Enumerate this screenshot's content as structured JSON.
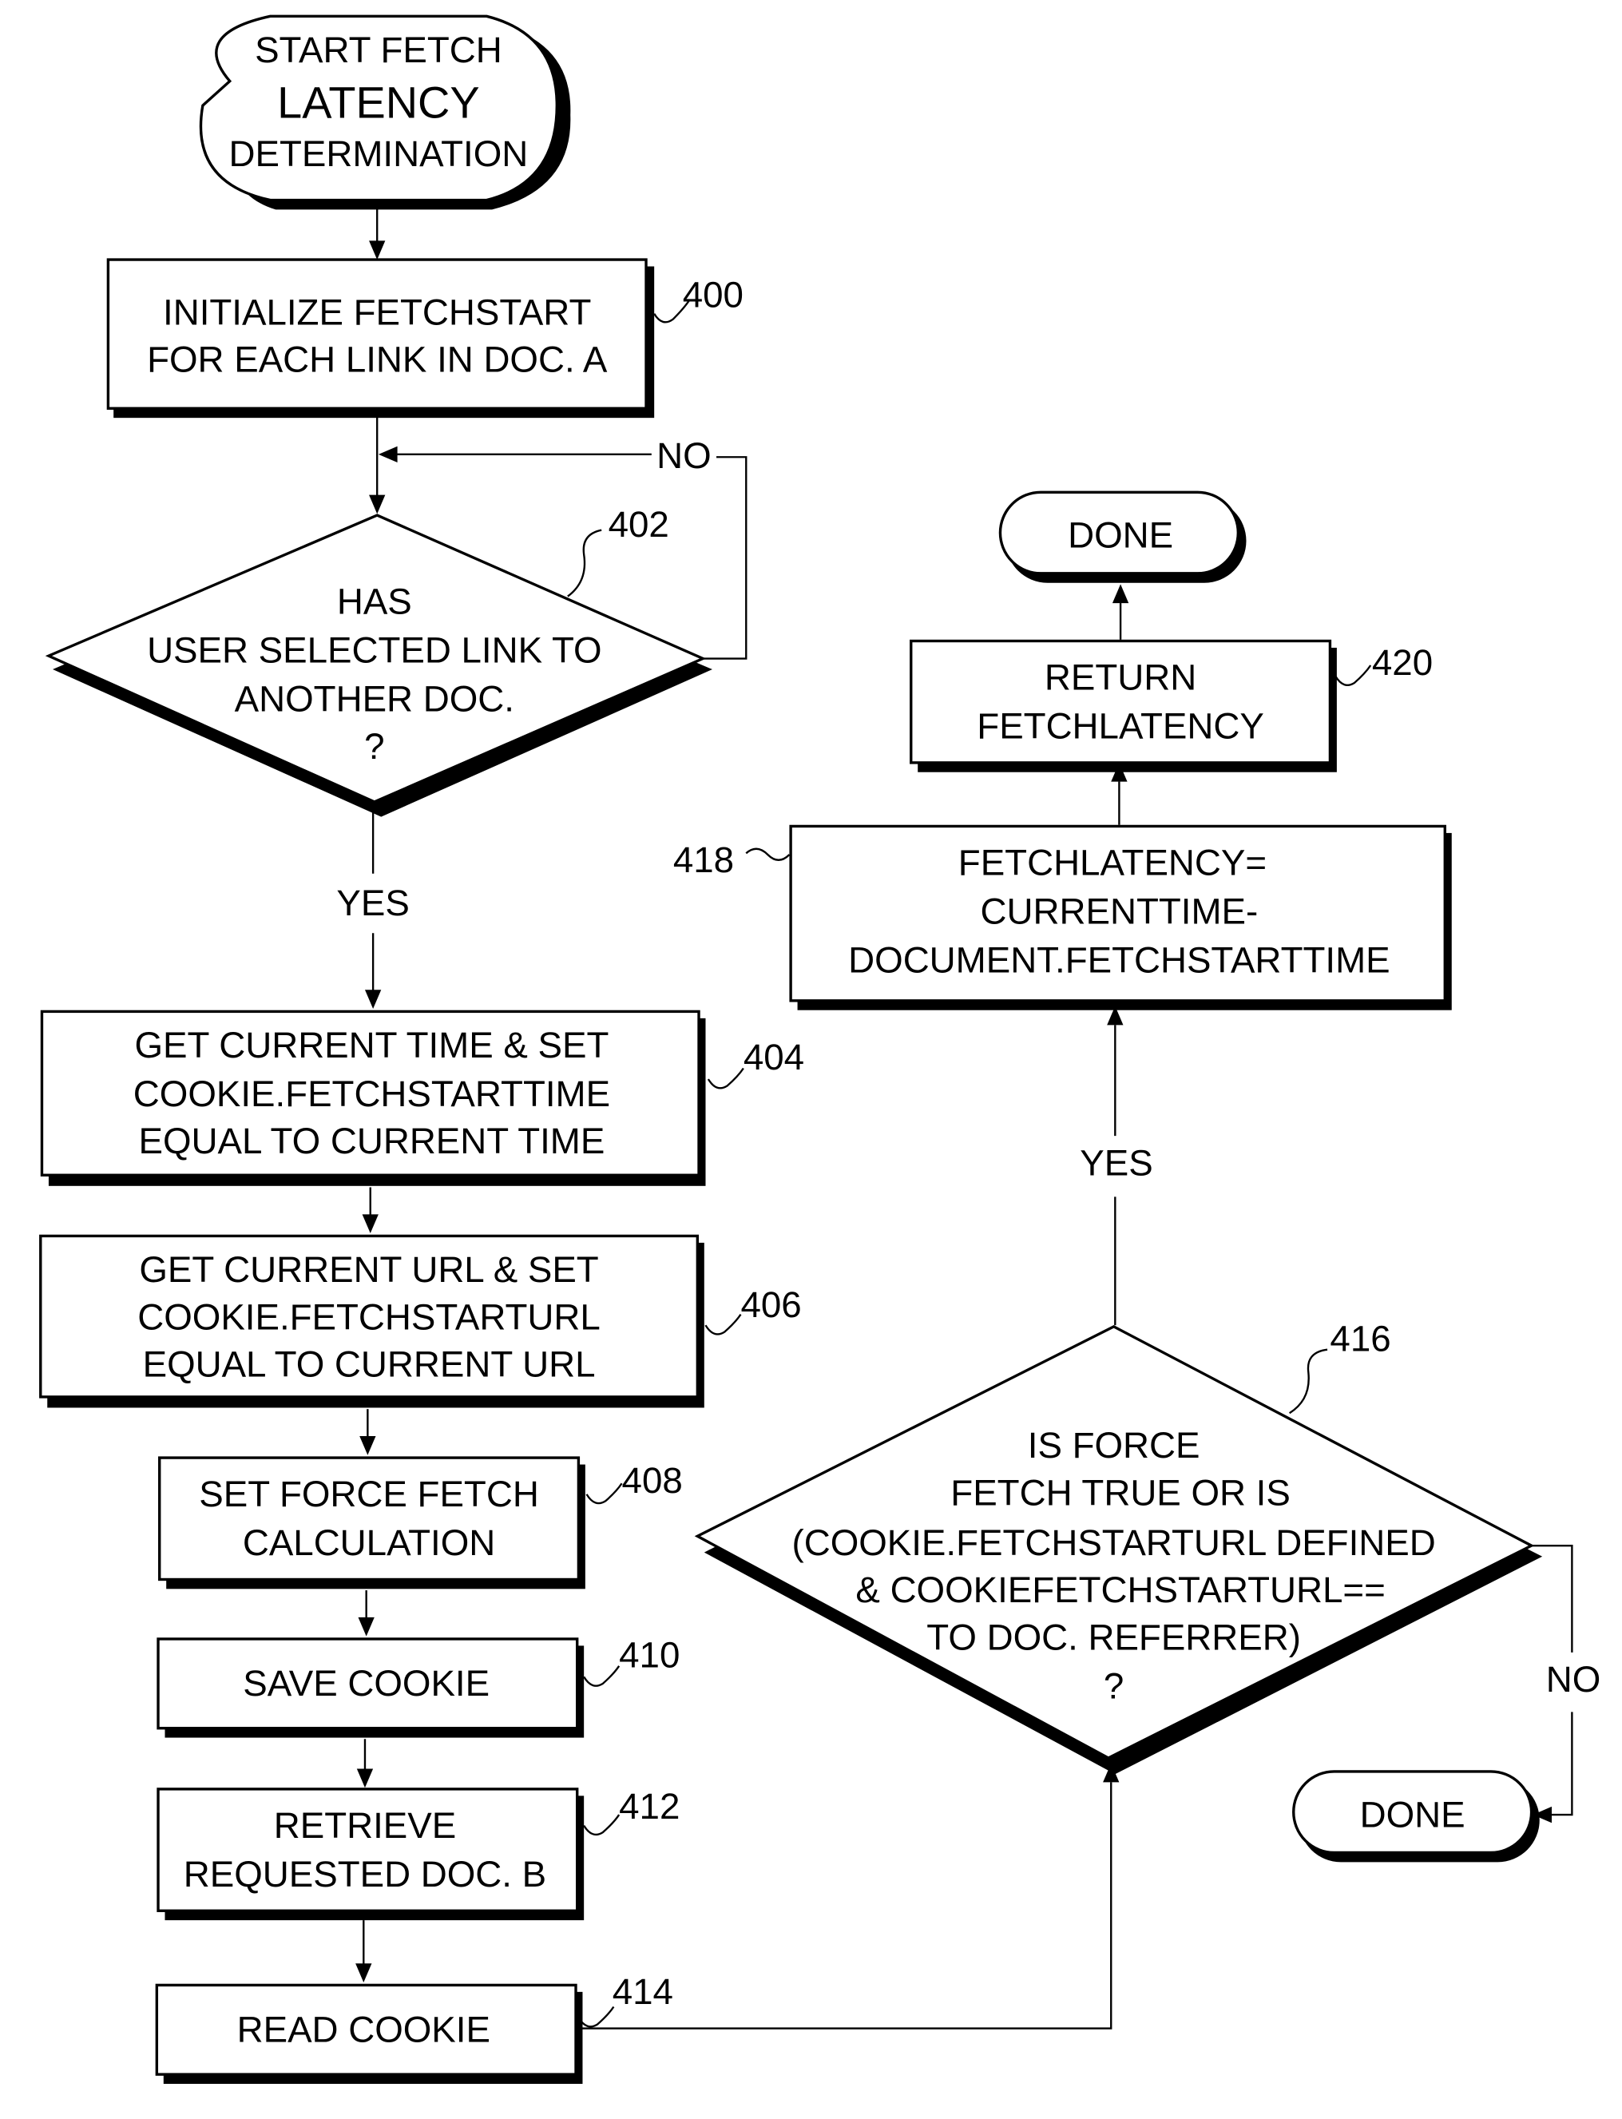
{
  "figure": {
    "type": "flowchart",
    "title": "Fetch latency determination"
  },
  "nodes": {
    "start": {
      "shape": "terminator",
      "lines": [
        "START FETCH",
        "LATENCY",
        "DETERMINATION"
      ]
    },
    "n400": {
      "ref": "400",
      "shape": "process",
      "lines": [
        "INITIALIZE FETCHSTART",
        "FOR EACH LINK IN DOC. A"
      ]
    },
    "n402": {
      "ref": "402",
      "shape": "decision",
      "lines": [
        "HAS",
        "USER SELECTED LINK TO",
        "ANOTHER DOC.",
        "?"
      ]
    },
    "n404": {
      "ref": "404",
      "shape": "process",
      "lines": [
        "GET CURRENT TIME & SET",
        "COOKIE.FETCHSTARTTIME",
        "EQUAL TO CURRENT TIME"
      ]
    },
    "n406": {
      "ref": "406",
      "shape": "process",
      "lines": [
        "GET CURRENT URL &  SET",
        "COOKIE.FETCHSTARTURL",
        "EQUAL TO CURRENT URL"
      ]
    },
    "n408": {
      "ref": "408",
      "shape": "process",
      "lines": [
        "SET FORCE FETCH",
        "CALCULATION"
      ]
    },
    "n410": {
      "ref": "410",
      "shape": "process",
      "lines": [
        "SAVE COOKIE"
      ]
    },
    "n412": {
      "ref": "412",
      "shape": "process",
      "lines": [
        "RETRIEVE",
        "REQUESTED DOC. B"
      ]
    },
    "n414": {
      "ref": "414",
      "shape": "process",
      "lines": [
        "READ COOKIE"
      ]
    },
    "n416": {
      "ref": "416",
      "shape": "decision",
      "lines": [
        "IS FORCE",
        "FETCH TRUE OR IS",
        "(COOKIE.FETCHSTARTURL DEFINED",
        "& COOKIEFETCHSTARTURL==",
        "TO DOC. REFERRER)",
        "?"
      ]
    },
    "n418": {
      "ref": "418",
      "shape": "process",
      "lines": [
        "FETCHLATENCY=",
        "CURRENTTIME-",
        "DOCUMENT.FETCHSTARTTIME"
      ]
    },
    "n420": {
      "ref": "420",
      "shape": "process",
      "lines": [
        "RETURN",
        "FETCHLATENCY"
      ]
    },
    "done_top": {
      "shape": "terminator",
      "lines": [
        "DONE"
      ]
    },
    "done_bottom": {
      "shape": "terminator",
      "lines": [
        "DONE"
      ]
    }
  },
  "edges": {
    "e402_no": {
      "from": "n402",
      "to": "n402",
      "label": "NO"
    },
    "e402_yes": {
      "from": "n402",
      "to": "n404",
      "label": "YES"
    },
    "e416_yes": {
      "from": "n416",
      "to": "n418",
      "label": "YES"
    },
    "e416_no": {
      "from": "n416",
      "to": "done_bottom",
      "label": "NO"
    },
    "sequence": [
      [
        "start",
        "n400"
      ],
      [
        "n400",
        "n402"
      ],
      [
        "n404",
        "n406"
      ],
      [
        "n406",
        "n408"
      ],
      [
        "n408",
        "n410"
      ],
      [
        "n410",
        "n412"
      ],
      [
        "n412",
        "n414"
      ],
      [
        "n414",
        "n416"
      ],
      [
        "n418",
        "n420"
      ],
      [
        "n420",
        "done_top"
      ]
    ]
  }
}
